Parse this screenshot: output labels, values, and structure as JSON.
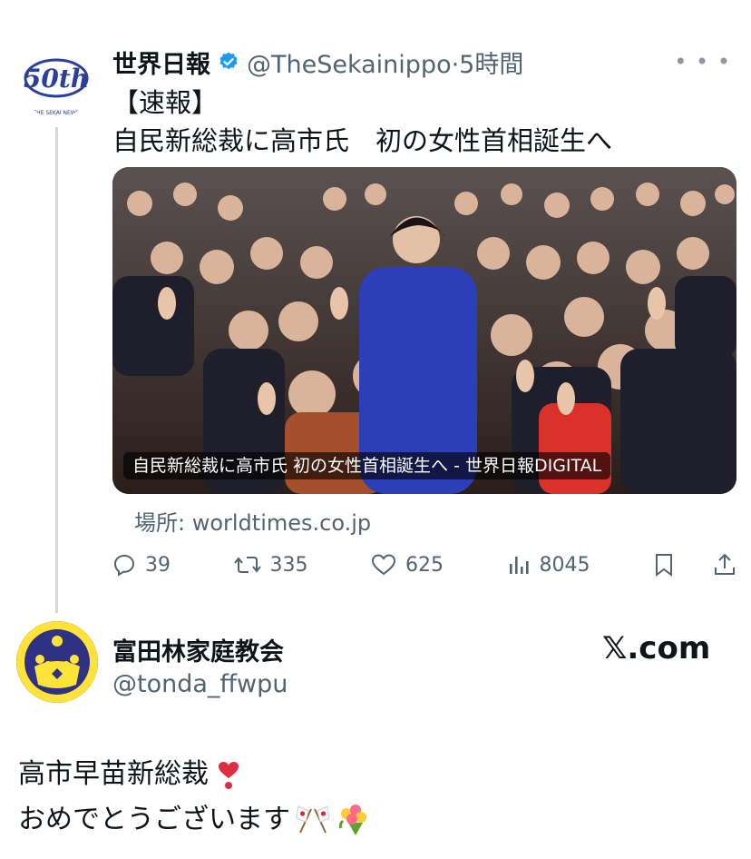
{
  "quoted_post": {
    "avatar_text": "50th",
    "avatar_caption": "THE SEKAI NEWS",
    "display_name": "世界日報",
    "handle_time": "@TheSekainippo·5時間",
    "text_line_1": "【速報】",
    "text_line_2": "自民新総裁に高市氏　初の女性首相誕生へ",
    "media_caption": "自民新総裁に高市氏 初の女性首相誕生へ - 世界日報DIGITAL",
    "source_link": "場所: worldtimes.co.jp",
    "stats": {
      "replies": "39",
      "reposts": "335",
      "likes": "625",
      "views": "8045"
    }
  },
  "post": {
    "display_name": "富田林家庭教会",
    "handle": "@tonda_ffwpu",
    "brand": "𝕏.com",
    "text_line_1": "高市早苗新総裁",
    "text_line_2": "おめでとうございます"
  },
  "colors": {
    "verified": "#1d9bf0",
    "muted": "#536471",
    "line": "#cfd9de"
  }
}
